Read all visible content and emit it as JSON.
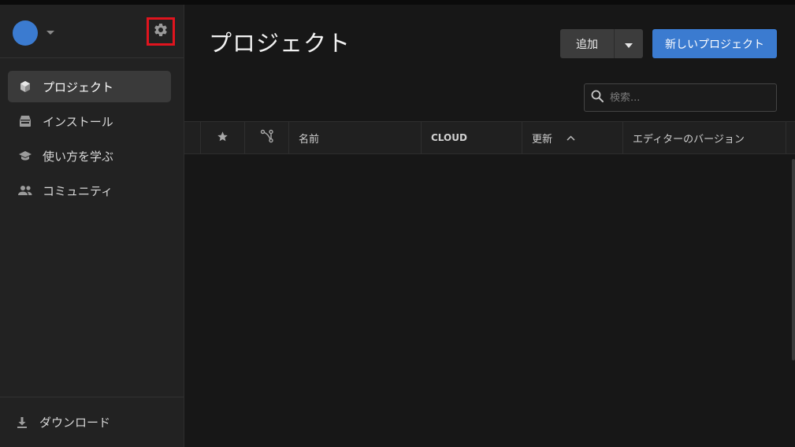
{
  "sidebar": {
    "items": [
      {
        "label": "プロジェクト",
        "icon": "cube-icon",
        "active": true
      },
      {
        "label": "インストール",
        "icon": "installs-icon",
        "active": false
      },
      {
        "label": "使い方を学ぶ",
        "icon": "graduation-cap-icon",
        "active": false
      },
      {
        "label": "コミュニティ",
        "icon": "people-icon",
        "active": false
      }
    ],
    "footer_label": "ダウンロード"
  },
  "header": {
    "title": "プロジェクト",
    "add_label": "追加",
    "new_project_label": "新しいプロジェクト"
  },
  "search": {
    "placeholder": "検索..."
  },
  "table": {
    "columns": {
      "name": "名前",
      "cloud": "CLOUD",
      "updated": "更新",
      "editor_version": "エディターのバージョン"
    }
  },
  "colors": {
    "accent": "#3b7bd0",
    "highlight_box": "#e0141e",
    "background": "#171717",
    "sidebar": "#222222"
  }
}
